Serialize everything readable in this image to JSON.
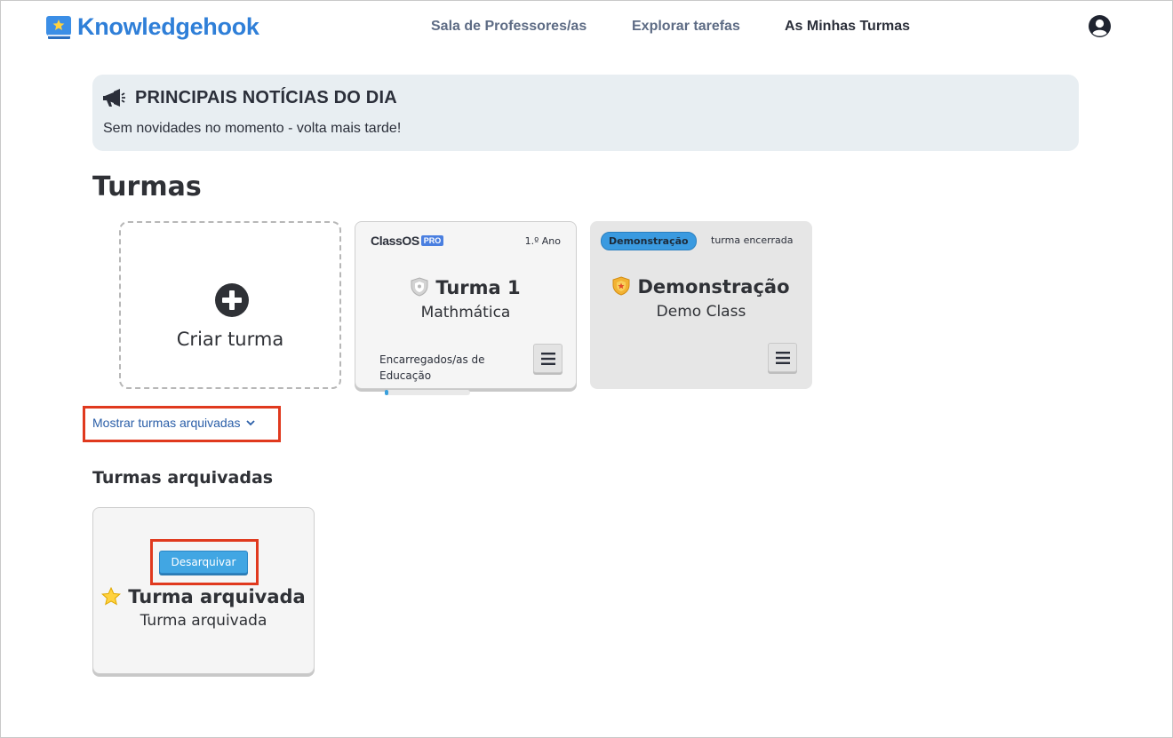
{
  "header": {
    "brand": "Knowledgehook",
    "nav": [
      {
        "label": "Sala de Professores/as",
        "active": false
      },
      {
        "label": "Explorar tarefas",
        "active": false
      },
      {
        "label": "As Minhas Turmas",
        "active": true
      }
    ],
    "user_icon": "user-circle-icon"
  },
  "news": {
    "icon": "megaphone-icon",
    "title": "PRINCIPAIS NOTÍCIAS DO DIA",
    "message": "Sem novidades no momento - volta mais tarde!"
  },
  "classes": {
    "heading": "Turmas",
    "create_label": "Criar turma",
    "cards": [
      {
        "brand": "ClassOS",
        "brand_badge": "PRO",
        "grade": "1.º Ano",
        "name": "Turma 1",
        "subject": "Mathmática",
        "guardians_label": "Encarregados/as de Educação",
        "progress_percent": 4,
        "shield_color": "#b9b9b9"
      },
      {
        "badge": "Demonstração",
        "status": "turma encerrada",
        "name": "Demonstração",
        "subject": "Demo Class",
        "shield_color": "#f2b233"
      }
    ],
    "show_archived_label": "Mostrar turmas arquivadas",
    "archived_heading": "Turmas arquivadas",
    "archived_cards": [
      {
        "unarchive_label": "Desarquivar",
        "name": "Turma arquivada",
        "subject": "Turma arquivada"
      }
    ]
  },
  "colors": {
    "brand": "#2f7fd8",
    "highlight": "#e0391e",
    "button": "#41a6e3"
  }
}
